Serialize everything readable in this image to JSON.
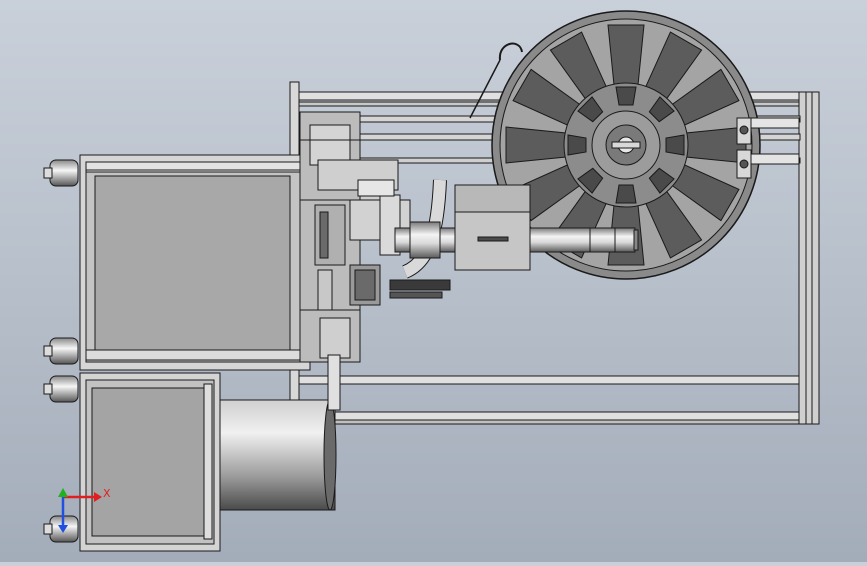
{
  "viewport": {
    "background_top": "#c9d0da",
    "background_bottom": "#a3acb9"
  },
  "colors": {
    "line": "#1a1a1a",
    "panel_gray": "#a8a8a8",
    "metal_light": "#e8e8e8",
    "metal_mid": "#b4b4b4",
    "metal_dark": "#6a6a6a",
    "axis_x": "#e02020",
    "axis_y": "#20b020",
    "axis_z": "#2050e0"
  },
  "triad": {
    "x_label": "X"
  }
}
